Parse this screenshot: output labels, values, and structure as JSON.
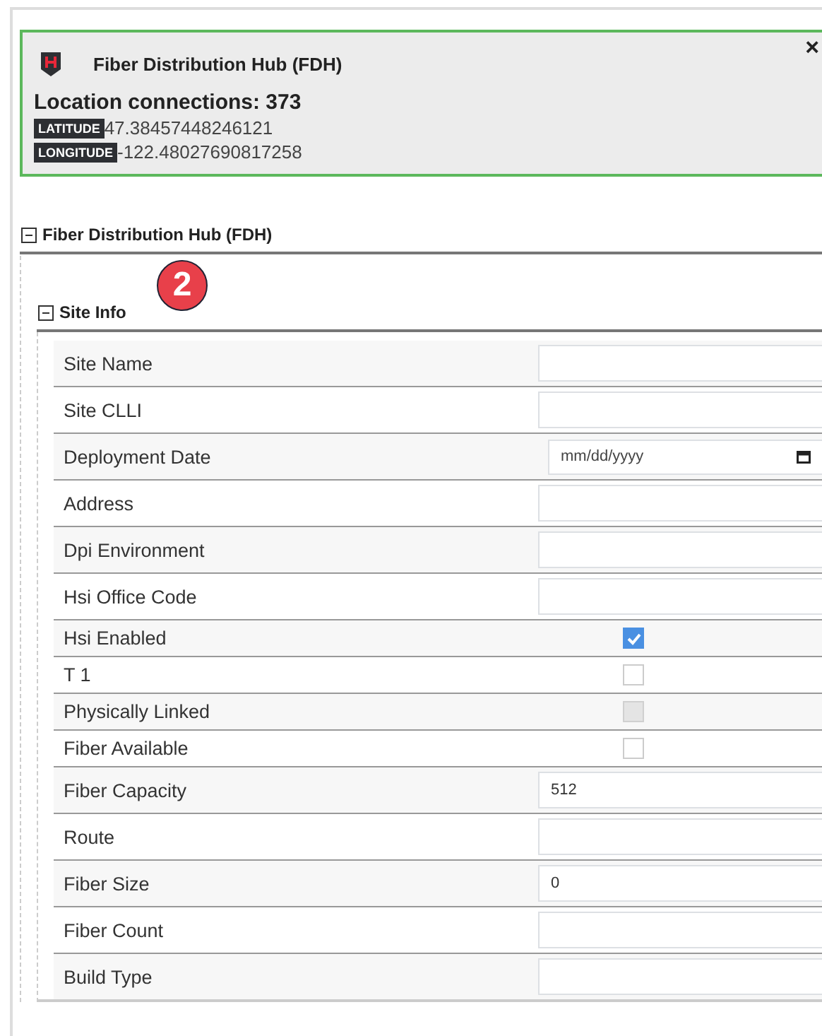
{
  "popup": {
    "title": "Fiber Distribution Hub (FDH)",
    "close": "×",
    "connections_label": "Location connections:",
    "connections": "373",
    "coords": [
      {
        "label": "LATITUDE",
        "value": "47.38457448246121"
      },
      {
        "label": "LONGITUDE",
        "value": "-122.48027690817258"
      }
    ]
  },
  "section": {
    "title": "Fiber Distribution Hub (FDH)",
    "expanded": true,
    "subsection": {
      "title": "Site Info",
      "expanded": true,
      "badge": "2",
      "fields": [
        {
          "label": "Site Name",
          "kind": "text"
        },
        {
          "label": "Site CLLI",
          "kind": "text"
        },
        {
          "label": "Deployment Date",
          "kind": "date",
          "placeholder": "mm/dd/yyyy"
        },
        {
          "label": "Address",
          "kind": "text"
        },
        {
          "label": "Dpi Environment",
          "kind": "text"
        },
        {
          "label": "Hsi Office Code",
          "kind": "text"
        },
        {
          "label": "Hsi Enabled",
          "kind": "checkbox",
          "checked": true,
          "disabled": false
        },
        {
          "label": "T 1",
          "kind": "checkbox",
          "checked": false,
          "disabled": false
        },
        {
          "label": "Physically Linked",
          "kind": "checkbox",
          "checked": false,
          "disabled": true
        },
        {
          "label": "Fiber Available",
          "kind": "checkbox",
          "checked": false,
          "disabled": false
        },
        {
          "label": "Fiber Capacity",
          "kind": "text",
          "value": "512"
        },
        {
          "label": "Route",
          "kind": "text"
        },
        {
          "label": "Fiber Size",
          "kind": "text",
          "value": "0"
        },
        {
          "label": "Fiber Count",
          "kind": "text"
        },
        {
          "label": "Build Type",
          "kind": "text"
        }
      ]
    }
  }
}
